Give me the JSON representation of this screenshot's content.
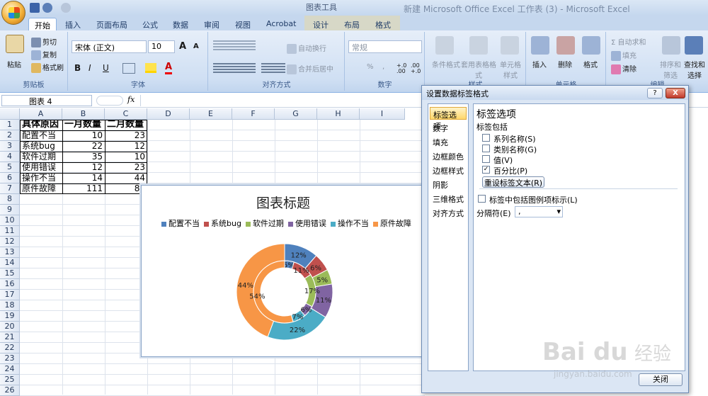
{
  "titlebar": {
    "title": "新建 Microsoft Office Excel 工作表 (3) - Microsoft Excel",
    "context_tools": "图表工具"
  },
  "tabs": [
    "开始",
    "插入",
    "页面布局",
    "公式",
    "数据",
    "审阅",
    "视图",
    "Acrobat",
    "设计",
    "布局",
    "格式"
  ],
  "ribbon": {
    "clipboard": {
      "label": "剪贴板",
      "paste": "粘贴",
      "cut": "剪切",
      "copy": "复制",
      "format_painter": "格式刷"
    },
    "font": {
      "label": "字体",
      "font_name": "宋体 (正文)",
      "font_size": "10",
      "grow": "A",
      "shrink": "A",
      "bold": "B",
      "italic": "I",
      "underline": "U",
      "font_color": "A"
    },
    "alignment": {
      "label": "对齐方式",
      "wrap": "自动换行",
      "merge": "合并后居中"
    },
    "number": {
      "label": "数字",
      "format": "常规",
      "percent": "%",
      "comma": ",",
      "inc_decimal": "+.0 .00",
      "dec_decimal": ".00 +.0"
    },
    "styles": {
      "label": "样式",
      "conditional": "条件格式",
      "table": "套用表格格式",
      "cell_styles": "单元格样式"
    },
    "cells": {
      "label": "单元格",
      "insert": "插入",
      "delete": "删除",
      "format": "格式"
    },
    "editing": {
      "label": "编辑",
      "autosum": "自动求和",
      "fill": "填充",
      "clear": "清除",
      "sort": "排序和筛选",
      "find": "查找和选择"
    }
  },
  "formula_bar": {
    "name_box": "图表 4",
    "fx": "fx"
  },
  "sheet": {
    "columns": [
      "A",
      "B",
      "C",
      "D",
      "E",
      "F",
      "G",
      "H",
      "I"
    ],
    "rows": [
      "1",
      "2",
      "3",
      "4",
      "5",
      "6",
      "7",
      "8",
      "9",
      "10",
      "11",
      "12",
      "13",
      "14",
      "15",
      "16",
      "17",
      "18",
      "19",
      "20",
      "21",
      "22",
      "23",
      "24",
      "25",
      "26"
    ],
    "header": [
      "具体原因",
      "一月数量",
      "二月数量"
    ],
    "data": [
      [
        "配置不当",
        "10",
        "23"
      ],
      [
        "系统bug",
        "22",
        "12"
      ],
      [
        "软件过期",
        "35",
        "10"
      ],
      [
        "使用错误",
        "12",
        "23"
      ],
      [
        "操作不当",
        "14",
        "44"
      ],
      [
        "原件故障",
        "111",
        "89"
      ]
    ]
  },
  "chart": {
    "title": "图表标题",
    "legend": [
      "配置不当",
      "系统bug",
      "软件过期",
      "使用错误",
      "操作不当",
      "原件故障"
    ],
    "colors": [
      "#4f81bd",
      "#c0504d",
      "#9bbb59",
      "#8064a2",
      "#4bacc6",
      "#f79646"
    ],
    "outer_labels": [
      "12%",
      "6%",
      "5%",
      "11%",
      "22%",
      "44%"
    ],
    "inner_labels": [
      "5%",
      "11%",
      "17%",
      "6%",
      "7%",
      "54%"
    ]
  },
  "chart_data": {
    "type": "doughnut",
    "title": "图表标题",
    "categories": [
      "配置不当",
      "系统bug",
      "软件过期",
      "使用错误",
      "操作不当",
      "原件故障"
    ],
    "series": [
      {
        "name": "一月数量",
        "values": [
          10,
          22,
          35,
          12,
          14,
          111
        ]
      },
      {
        "name": "二月数量",
        "values": [
          23,
          12,
          10,
          23,
          44,
          89
        ]
      }
    ],
    "legend": "top"
  },
  "dialog": {
    "title": "设置数据标签格式",
    "help": "?",
    "close_x": "X",
    "nav": [
      "标签选项",
      "数字",
      "填充",
      "边框颜色",
      "边框样式",
      "阴影",
      "三维格式",
      "对齐方式"
    ],
    "heading": "标签选项",
    "subheading": "标签包括",
    "options": [
      {
        "label": "系列名称(S)",
        "checked": false
      },
      {
        "label": "类别名称(G)",
        "checked": false
      },
      {
        "label": "值(V)",
        "checked": false
      },
      {
        "label": "百分比(P)",
        "checked": true
      }
    ],
    "reset_button": "重设标签文本(R)",
    "legend_key": "标签中包括图例项标示(L)",
    "separator_label": "分隔符(E)",
    "separator_value": ",",
    "close_button": "关闭"
  },
  "watermark": "Bai du 经验 jingyan.baidu.com"
}
